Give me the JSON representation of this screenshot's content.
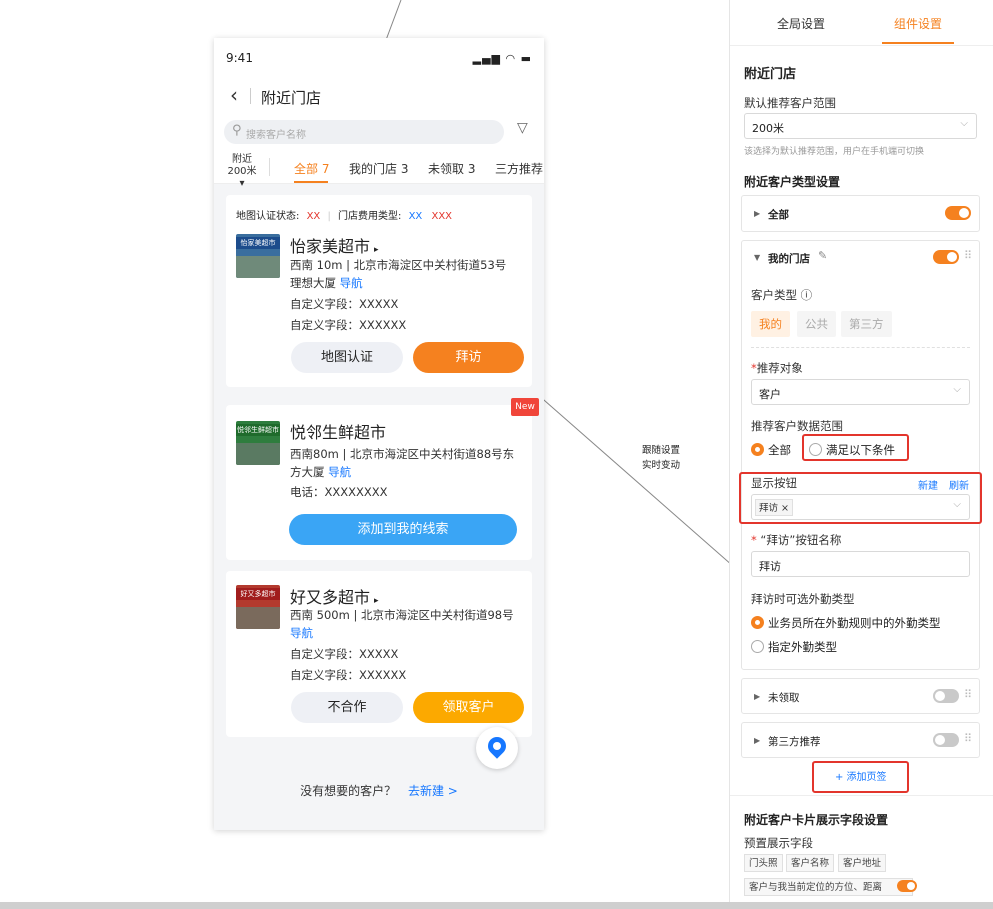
{
  "annotation": {
    "line1": "跟随设置",
    "line2": "实时变动"
  },
  "phone": {
    "status_time": "9:41",
    "nav_title": "附近门店",
    "search_placeholder": "搜索客户名称",
    "range": {
      "line1": "附近",
      "line2": "200米 ▾"
    },
    "tabs": [
      {
        "label": "全部 7",
        "active": true
      },
      {
        "label": "我的门店 3"
      },
      {
        "label": "未领取 3"
      },
      {
        "label": "三方推荐"
      }
    ],
    "card1": {
      "filter_label1": "地图认证状态:",
      "filter_tag1": "XX",
      "filter_label2": "门店费用类型:",
      "filter_tag2": "XX",
      "filter_tag3": "XXX",
      "sign": "怡家美超市",
      "name": "怡家美超市",
      "addr1": "西南 10m | 北京市海淀区中关村街道53号",
      "addr2": "理想大厦",
      "nav_link": "导航",
      "field1": "自定义字段：XXXXX",
      "field2": "自定义字段：XXXXXX",
      "btn_left": "地图认证",
      "btn_right": "拜访"
    },
    "card2": {
      "badge": "New",
      "sign": "悦邻生鲜超市",
      "name": "悦邻生鲜超市",
      "addr1": "西南80m | 北京市海淀区中关村街道88号东",
      "addr2": "方大厦",
      "nav_link": "导航",
      "phone": "电话：XXXXXXXX",
      "btn": "添加到我的线索"
    },
    "card3": {
      "sign": "好又多超市",
      "name": "好又多超市",
      "addr1": "西南 500m | 北京市海淀区中关村街道98号",
      "nav_link": "导航",
      "field1": "自定义字段：XXXXX",
      "field2": "自定义字段：XXXXXX",
      "btn_left": "不合作",
      "btn_right": "领取客户"
    },
    "footer_text": "没有想要的客户？",
    "footer_link": "去新建 >"
  },
  "panel": {
    "tabs": [
      {
        "label": "全局设置"
      },
      {
        "label": "组件设置",
        "active": true
      }
    ],
    "section_title": "附近门店",
    "default_range_label": "默认推荐客户范围",
    "default_range_value": "200米",
    "default_range_hint": "该选择为默认推荐范围，用户在手机端可切换",
    "type_setting_title": "附近客户类型设置",
    "sec_all": "全部",
    "sec_mine": "我的门店",
    "customer_type_label": "客户类型 ⓘ",
    "chips": [
      "我的",
      "公共",
      "第三方"
    ],
    "target_label": "推荐对象",
    "target_value": "客户",
    "data_range_label": "推荐客户数据范围",
    "radio_all": "全部",
    "radio_cond": "满足以下条件",
    "show_btn_label": "显示按钮",
    "new_link": "新建",
    "refresh_link": "刷新",
    "show_btn_tag": "拜访 ×",
    "visit_name_label": "“拜访”按钮名称",
    "visit_name_value": "拜访",
    "visit_type_label": "拜访时可选外勤类型",
    "radio_rule": "业务员所在外勤规则中的外勤类型",
    "radio_specify": "指定外勤类型",
    "sec_unclaimed": "未领取",
    "sec_third": "第三方推荐",
    "add_tab": "+ 添加页签",
    "card_fields_title": "附近客户卡片展示字段设置",
    "preset_label": "预置展示字段",
    "preset_tags": [
      "门头照",
      "客户名称",
      "客户地址"
    ],
    "preset_tag4": "客户与我当前定位的方位、距离"
  },
  "colors": {
    "accent": "#f5811f",
    "link": "#1677ff",
    "highlight": "#e3352c"
  }
}
